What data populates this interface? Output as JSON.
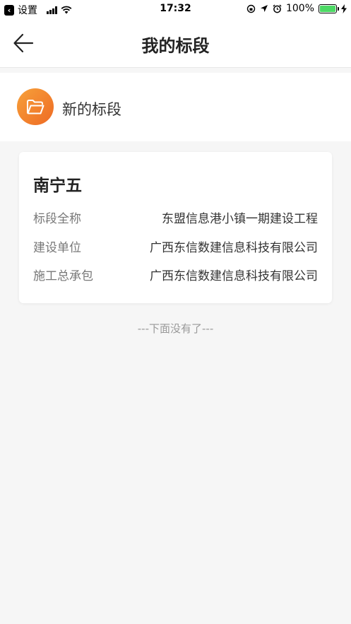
{
  "status_bar": {
    "back_app": "设置",
    "time": "17:32",
    "battery": "100%",
    "battery_level": 1.0,
    "signal_icon": "signal-bars-icon",
    "wifi_icon": "wifi-icon"
  },
  "header": {
    "title": "我的标段",
    "back_icon": "arrow-left-icon"
  },
  "new_section": {
    "label": "新的标段",
    "icon": "folder-icon",
    "icon_colors": [
      "#f7a13a",
      "#ee6a24"
    ]
  },
  "card": {
    "title": "南宁五",
    "rows": [
      {
        "key": "标段全称",
        "value": "东盟信息港小镇一期建设工程"
      },
      {
        "key": "建设单位",
        "value": "广西东信数建信息科技有限公司"
      },
      {
        "key": "施工总承包",
        "value": "广西东信数建信息科技有限公司"
      }
    ]
  },
  "list_end": "---下面没有了---"
}
